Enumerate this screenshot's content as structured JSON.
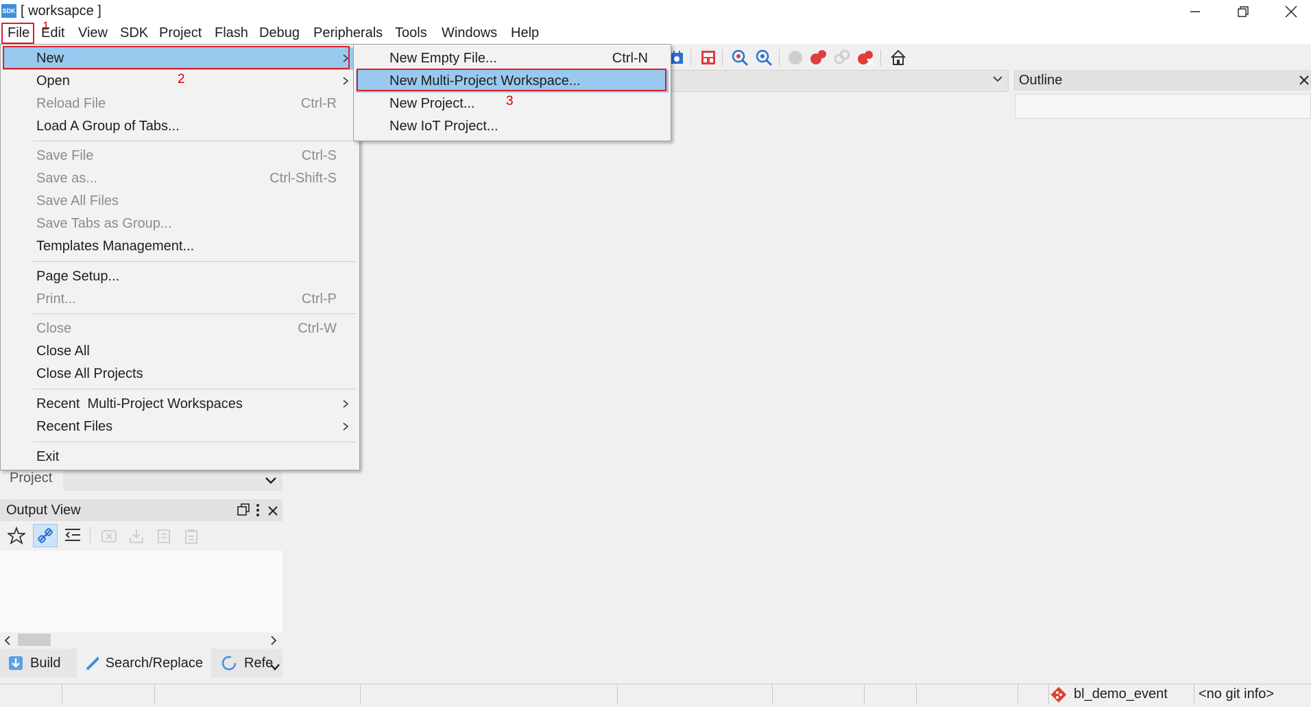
{
  "window": {
    "title": "[ worksapce ]",
    "icon_text": "SDK"
  },
  "menubar": [
    "File",
    "Edit",
    "View",
    "SDK",
    "Project",
    "Flash",
    "Debug",
    "Peripherals",
    "Tools",
    "Windows",
    "Help"
  ],
  "annotations": {
    "step1": "1",
    "step2": "2",
    "step3": "3"
  },
  "file_menu": {
    "new": "New",
    "open": "Open",
    "reload": "Reload File",
    "reload_sc": "Ctrl-R",
    "load_group": "Load A Group of Tabs...",
    "save": "Save File",
    "save_sc": "Ctrl-S",
    "save_as": "Save as...",
    "save_as_sc": "Ctrl-Shift-S",
    "save_all": "Save All Files",
    "save_tabs": "Save Tabs as Group...",
    "templates": "Templates Management...",
    "page_setup": "Page Setup...",
    "print": "Print...",
    "print_sc": "Ctrl-P",
    "close": "Close",
    "close_sc": "Ctrl-W",
    "close_all": "Close All",
    "close_all_projects": "Close All Projects",
    "recent_workspaces": "Recent  Multi-Project Workspaces",
    "recent_files": "Recent Files",
    "exit": "Exit"
  },
  "new_submenu": {
    "empty_file": "New Empty File...",
    "empty_file_sc": "Ctrl-N",
    "multi_workspace": "New Multi-Project Workspace...",
    "project": "New Project...",
    "iot_project": "New IoT Project..."
  },
  "outline": {
    "title": "Outline"
  },
  "project_bar": {
    "label": "Project"
  },
  "output_view": {
    "title": "Output View"
  },
  "bottom_tabs": [
    "Build",
    "Search/Replace",
    "Refe"
  ],
  "statusbar": {
    "branch": "bl_demo_event",
    "git": "<no git info>"
  },
  "colors": {
    "highlight": "#99c9ef",
    "annotation_red": "#d9202a",
    "accent_blue": "#2a6fd6"
  }
}
